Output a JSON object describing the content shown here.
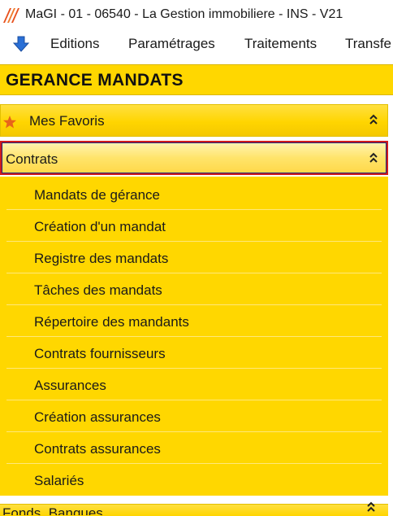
{
  "window": {
    "title": "MaGI - 01 - 06540 - La Gestion immobiliere - INS - V21"
  },
  "menu": {
    "items": [
      "Editions",
      "Paramétrages",
      "Traitements",
      "Transfe"
    ]
  },
  "section": {
    "title": "GERANCE MANDATS"
  },
  "groups": {
    "favoris": {
      "label": "Mes Favoris",
      "icon": "star-icon",
      "chevron": "⌃⌃"
    },
    "contrats": {
      "label": "Contrats",
      "chevron": "⌃⌃"
    }
  },
  "contrats_items": [
    "Mandats de gérance",
    "Création d'un mandat",
    "Registre des mandats",
    "Tâches des mandats",
    "Répertoire des mandants",
    "Contrats fournisseurs",
    "Assurances",
    "Création assurances",
    "Contrats assurances",
    "Salariés"
  ],
  "next_group": {
    "label": "Fonds, Banques, ..."
  },
  "colors": {
    "panel_yellow": "#ffd700",
    "highlight_border": "#d11a1a",
    "focus_border": "#1b2a80"
  }
}
